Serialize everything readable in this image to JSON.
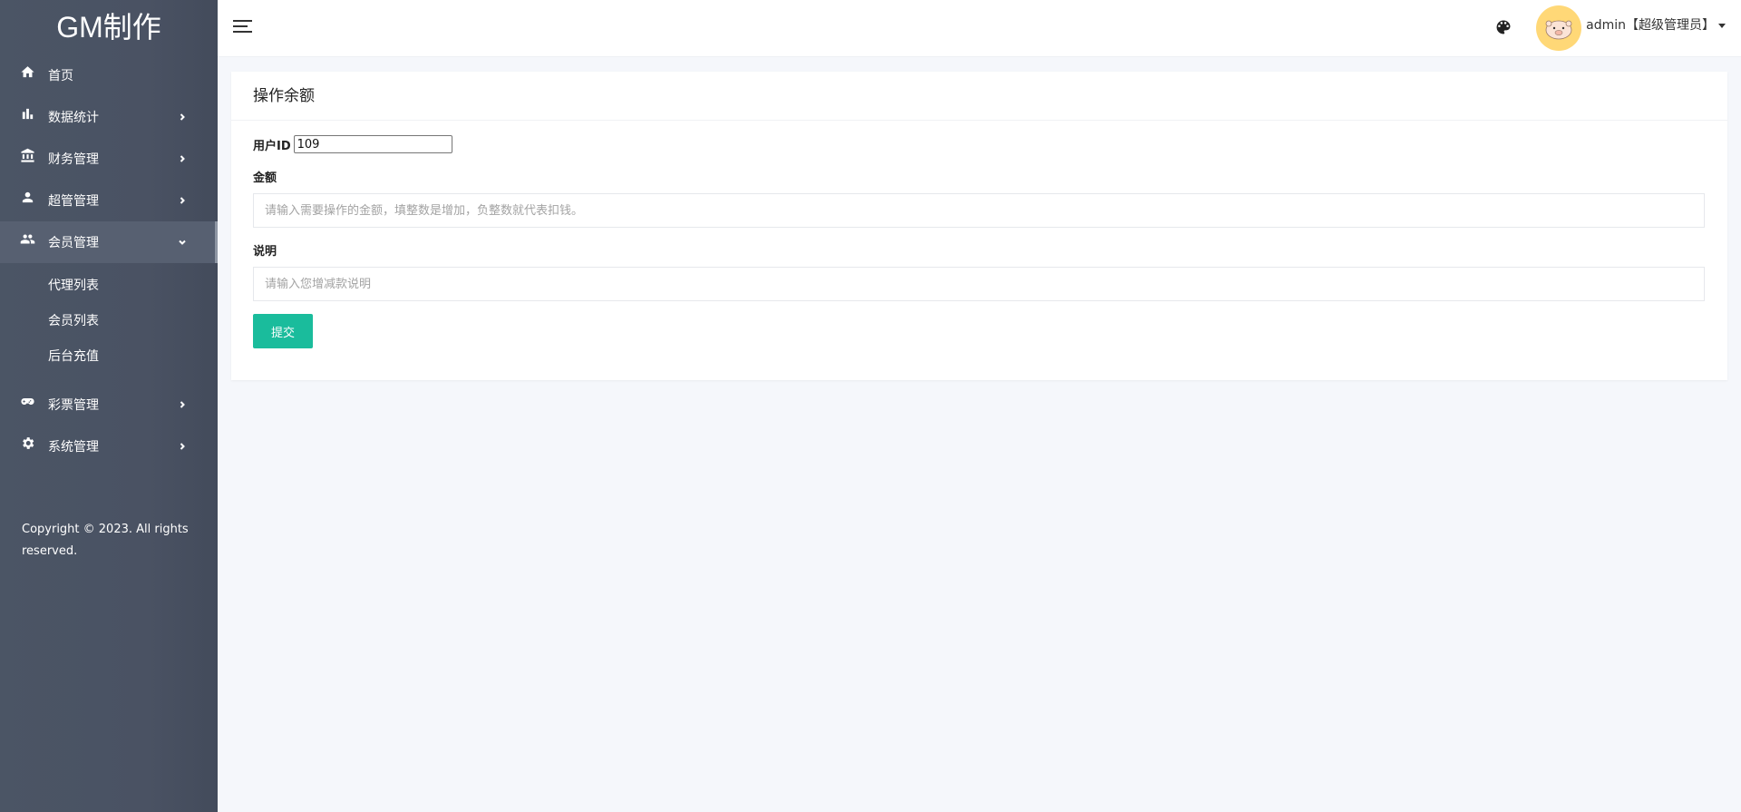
{
  "brand": "GM制作",
  "sidebar": {
    "items": [
      {
        "label": "首页"
      },
      {
        "label": "数据统计"
      },
      {
        "label": "财务管理"
      },
      {
        "label": "超管管理"
      },
      {
        "label": "会员管理"
      },
      {
        "label": "彩票管理"
      },
      {
        "label": "系统管理"
      }
    ],
    "sub_items": [
      {
        "label": "代理列表"
      },
      {
        "label": "会员列表"
      },
      {
        "label": "后台充值"
      }
    ],
    "copyright": "Copyright © 2023. All rights reserved."
  },
  "header": {
    "user": "admin【超级管理员】"
  },
  "card": {
    "title": "操作余额",
    "user_id_label": "用户ID",
    "user_id_value": "109",
    "amount_label": "金额",
    "amount_placeholder": "请输入需要操作的金额，填整数是增加，负整数就代表扣钱。",
    "desc_label": "说明",
    "desc_placeholder": "请输入您增减款说明",
    "submit_label": "提交"
  },
  "colors": {
    "sidebar_bg": "#4b5565",
    "accent": "#1abc9c",
    "avatar_bg": "#ffd877"
  }
}
